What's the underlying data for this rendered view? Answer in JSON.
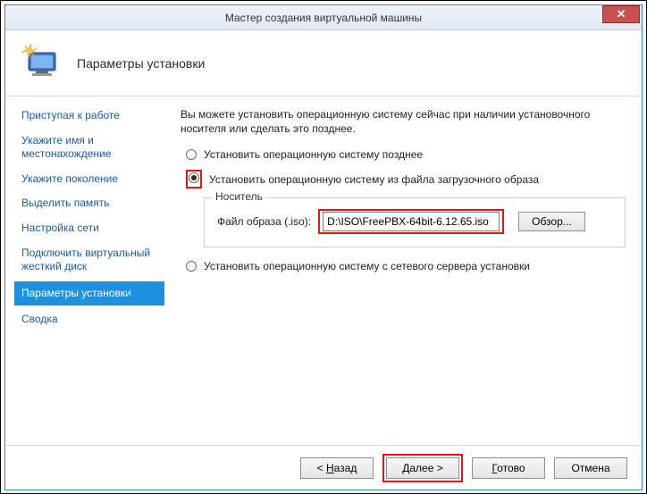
{
  "titlebar": {
    "title": "Мастер создания виртуальной машины"
  },
  "header": {
    "title": "Параметры установки"
  },
  "sidebar": {
    "items": [
      {
        "label": "Приступая к работе"
      },
      {
        "label": "Укажите имя и местонахождение"
      },
      {
        "label": "Укажите поколение"
      },
      {
        "label": "Выделить память"
      },
      {
        "label": "Настройка сети"
      },
      {
        "label": "Подключить виртуальный жесткий диск"
      },
      {
        "label": "Параметры установки"
      },
      {
        "label": "Сводка"
      }
    ],
    "selected_index": 6
  },
  "content": {
    "intro": "Вы можете установить операционную систему сейчас при наличии установочного носителя или сделать это позднее.",
    "opt_later": "Установить операционную систему позднее",
    "opt_image": "Установить операционную систему из файла загрузочного образа",
    "opt_network": "Установить операционную систему с сетевого сервера установки",
    "fieldset_legend": "Носитель",
    "iso_label": "Файл образа (.iso):",
    "iso_value": "D:\\ISO\\FreePBX-64bit-6.12.65.iso",
    "browse_label": "Обзор..."
  },
  "footer": {
    "back_prefix": "< ",
    "back_u": "Н",
    "back_rest": "азад",
    "next_u": "Д",
    "next_rest": "алее >",
    "finish_u": "Г",
    "finish_rest": "отово",
    "cancel": "Отмена"
  }
}
